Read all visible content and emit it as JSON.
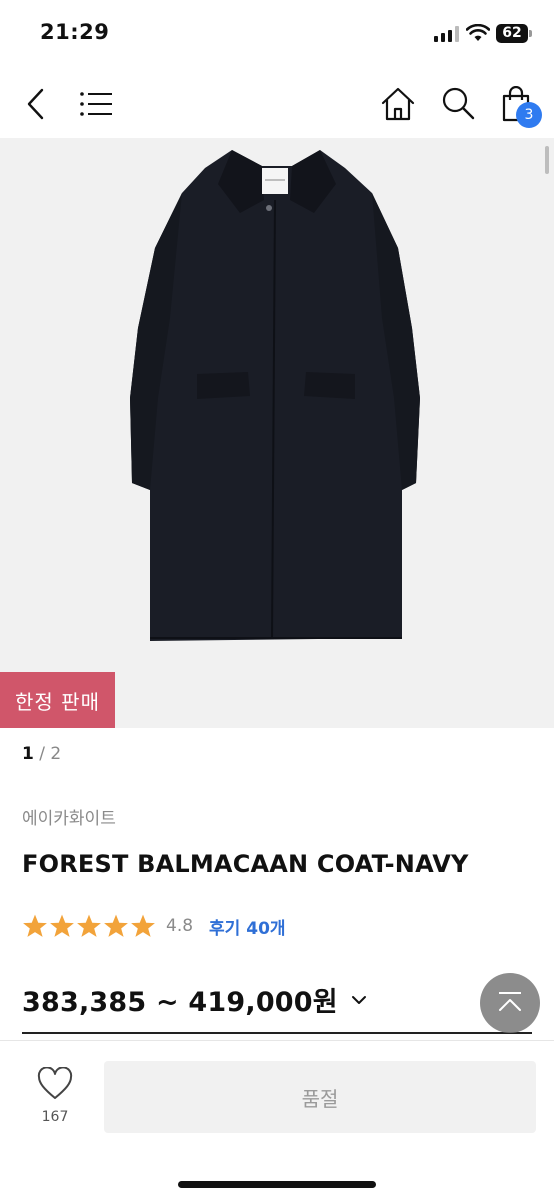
{
  "status_bar": {
    "time": "21:29",
    "battery": "62"
  },
  "nav": {
    "back_icon": "chevron-left-icon",
    "menu_icon": "menu-icon",
    "home_icon": "home-icon",
    "search_icon": "search-icon",
    "cart_icon": "shopping-bag-icon",
    "cart_count": "3"
  },
  "product": {
    "badge": "한정 판매",
    "pager_current": "1",
    "pager_total": " / 2",
    "brand": "에이카화이트",
    "title": "FOREST BALMACAAN COAT-NAVY",
    "rating": 4.8,
    "rating_text": "4.8",
    "reviews": "후기 40개",
    "price": "383,385 ~ 419,000원"
  },
  "bottom": {
    "wish_count": "167",
    "soldout_label": "품절"
  },
  "colors": {
    "accent_blue": "#2f7bf0",
    "badge_red": "#d0566a",
    "star": "#f2a33a",
    "coat": "#1a1d26"
  }
}
